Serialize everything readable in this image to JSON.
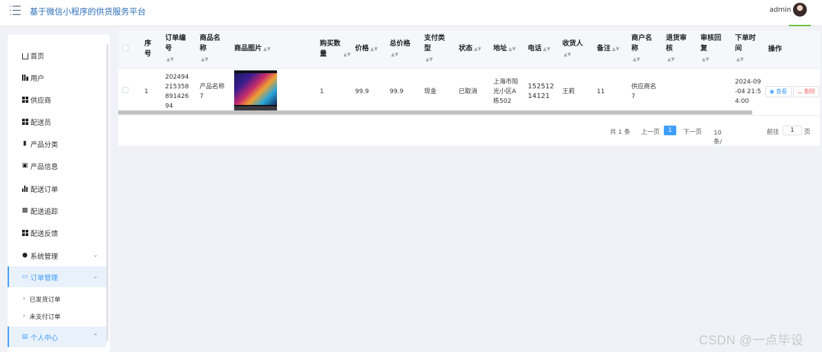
{
  "header": {
    "title": "基于微信小程序的供货服务平台",
    "user": "admin"
  },
  "sidebar": {
    "items": [
      {
        "label": "首页"
      },
      {
        "label": "用户"
      },
      {
        "label": "供应商"
      },
      {
        "label": "配送员"
      },
      {
        "label": "产品分类"
      },
      {
        "label": "产品信息"
      },
      {
        "label": "配送订单"
      },
      {
        "label": "配送追踪"
      },
      {
        "label": "配送反馈"
      },
      {
        "label": "系统管理"
      },
      {
        "label": "订单管理"
      },
      {
        "label": "个人中心"
      }
    ],
    "sub_items": [
      {
        "label": "已发货订单"
      },
      {
        "label": "未支付订单"
      }
    ]
  },
  "table": {
    "columns": [
      "序号",
      "订单编号",
      "商品名称",
      "商品图片",
      "购买数量",
      "价格",
      "总价格",
      "支付类型",
      "状态",
      "地址",
      "电话",
      "收货人",
      "备注",
      "商户名称",
      "退货审核",
      "审核回复",
      "下单时间",
      "操作"
    ],
    "rows": [
      {
        "index": "1",
        "order_no": "20249421535889142694",
        "product_name": "产品名称7",
        "quantity": "1",
        "price": "99.9",
        "total": "99.9",
        "pay_type": "现金",
        "status": "已取消",
        "address": "上海市阳光小区A栋502",
        "phone": "15251214121",
        "receiver": "王莉",
        "remark": "11",
        "merchant": "供应商名7",
        "return_audit": "",
        "audit_reply": "",
        "order_time": "2024-09-04 21:54:00"
      }
    ],
    "actions": {
      "view": "查看",
      "delete": "删除"
    }
  },
  "pagination": {
    "total": "共 1 条",
    "prev": "上一页",
    "current": "1",
    "next": "下一页",
    "page_size": "10条/页",
    "goto": "前往",
    "goto_value": "1",
    "page_unit": "页"
  },
  "watermark": "CSDN @一点毕设"
}
